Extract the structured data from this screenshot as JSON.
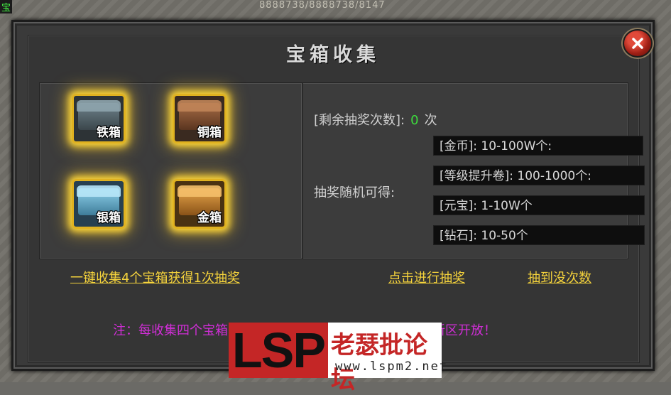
{
  "background": {
    "corner_label": "宝",
    "top_text": "8888738/8888738/8147"
  },
  "dialog": {
    "title": "宝箱收集",
    "chests": [
      {
        "label": "铁箱"
      },
      {
        "label": "铜箱"
      },
      {
        "label": "银箱"
      },
      {
        "label": "金箱"
      }
    ],
    "remaining_label": "[剩余抽奖次数]:",
    "remaining_count": "0",
    "remaining_unit": "次",
    "random_label": "抽奖随机可得:",
    "rewards": [
      "[金币]: 10-100W个:",
      "[等级提升卷]: 100-1000个:",
      "[元宝]: 1-10W个",
      "[钻石]: 10-50个"
    ],
    "links": {
      "collect": "一键收集4个宝箱获得1次抽奖",
      "draw": "点击进行抽奖",
      "draw_none": "抽到没次数"
    },
    "note": "注：每收集四个宝箱，可获得一次抽奖机会，此功能只在新区开放！"
  },
  "watermark": {
    "logo_text": "LSP",
    "site_name": "老瑟批论坛",
    "url": "www.lspm2.net"
  },
  "colors": {
    "link": "#f5d33c",
    "note": "#d02ed6",
    "count": "#3ddc3d",
    "chest_glow": "#ffd93a"
  }
}
